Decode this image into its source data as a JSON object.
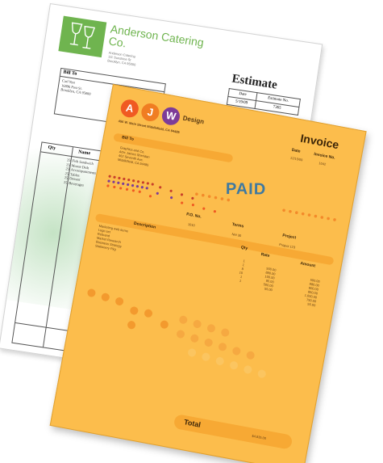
{
  "estimate": {
    "company": "Anderson Catering Co.",
    "address": [
      "Anderson Catering",
      "111 Sunshine St",
      "Brooklyn, CA 95000"
    ],
    "title": "Estimate",
    "meta_headers": [
      "Date",
      "Estimate No."
    ],
    "meta_values": [
      "5/19/09",
      "7365"
    ],
    "bill_to_label": "Bill To",
    "bill_to_lines": [
      "Carl Nye",
      "16896 Post St.",
      "Brooklyn, CA 95000"
    ],
    "col_qty": "Qty",
    "col_name": "Name",
    "items": [
      "Fish Sandwich",
      "Moose Dish",
      "Accompaniments",
      "Tables",
      "Dessert",
      "Beverages"
    ],
    "qtys": [
      "25",
      "25",
      "25",
      "25",
      "25",
      "25"
    ],
    "colors": {
      "accent": "#6fb44f"
    }
  },
  "invoice": {
    "logo_letters": [
      "A",
      "J",
      "W"
    ],
    "brand": "Design",
    "street": "456 W. Main Street Middlefield, CA 94485",
    "title": "Invoice",
    "date_label": "Date",
    "invoice_no_label": "Invoice No.",
    "date_value": "12/15/09",
    "invoice_no_value": "1042",
    "bill_to_label": "Bill To",
    "bill_to_lines": [
      "Graphics and Co.",
      "Attn: James Sheridan",
      "462 Seventh Ave.",
      "Middlefield, CA 94485"
    ],
    "stamp": "PAID",
    "po_label": "P.O. No.",
    "po_value": "1010",
    "terms_label": "Terms",
    "terms_value": "Net 30",
    "project_label": "Project",
    "project_value": "Project 123",
    "description_label": "Description",
    "qty_label": "Qty",
    "rate_label": "Rate",
    "amount_label": "Amount",
    "descriptions": [
      "Marketing web items",
      "Logo set",
      "Rebrand",
      "Market Research",
      "Business Strategy",
      "Stationery Pkg"
    ],
    "qtys": [
      "1",
      "1",
      "8",
      "10",
      "1",
      "1"
    ],
    "rates": [
      "500.00",
      "880.00",
      "100.00",
      "85.00",
      "500.00",
      "55.00"
    ],
    "amounts": [
      "500.00",
      "880.00",
      "800.00",
      "850.00",
      "1,000.00",
      "750.00",
      "55.00"
    ],
    "total_label": "Total",
    "total_value": "$4,835.00",
    "colors": {
      "paper": "#fcbd4c",
      "band": "#f7a934",
      "circle_a": "#f05a22",
      "circle_j": "#f07d22",
      "circle_w": "#7d3c98",
      "stamp": "#2f74a8"
    }
  }
}
